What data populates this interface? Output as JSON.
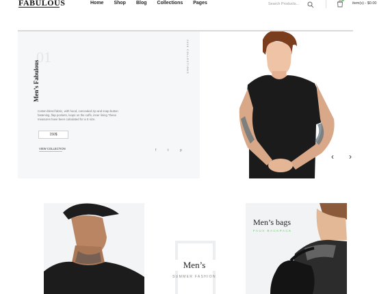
{
  "header": {
    "logo": "FABULOUS",
    "nav": [
      "Home",
      "Shop",
      "Blog",
      "Collections",
      "Pages"
    ],
    "search_placeholder": "Search Products...",
    "cart_text": "item(s) - $0.00",
    "accent_color": "#7bc67b"
  },
  "slider": {
    "slide_number": "01",
    "title": "Men’s Fabulous",
    "collection_label": "2016 COLLECTIONS",
    "description": "Cotton-blend fabric, with hood, concealed zip and snap button fastening, flap pockets, loops on the cuffs, inner lining These measures have been calculated for a S size.",
    "price": "150$",
    "view_link": "VIEW COLLECTION",
    "social": [
      "f",
      "t",
      "p"
    ],
    "arrow_prev": "‹",
    "arrow_next": "›"
  },
  "banners": {
    "center_title": "Men’s",
    "center_subtitle": "SUMMER FASHION",
    "right_title": "Men’s bags",
    "right_subtitle": "FAUX BACKPACK"
  }
}
